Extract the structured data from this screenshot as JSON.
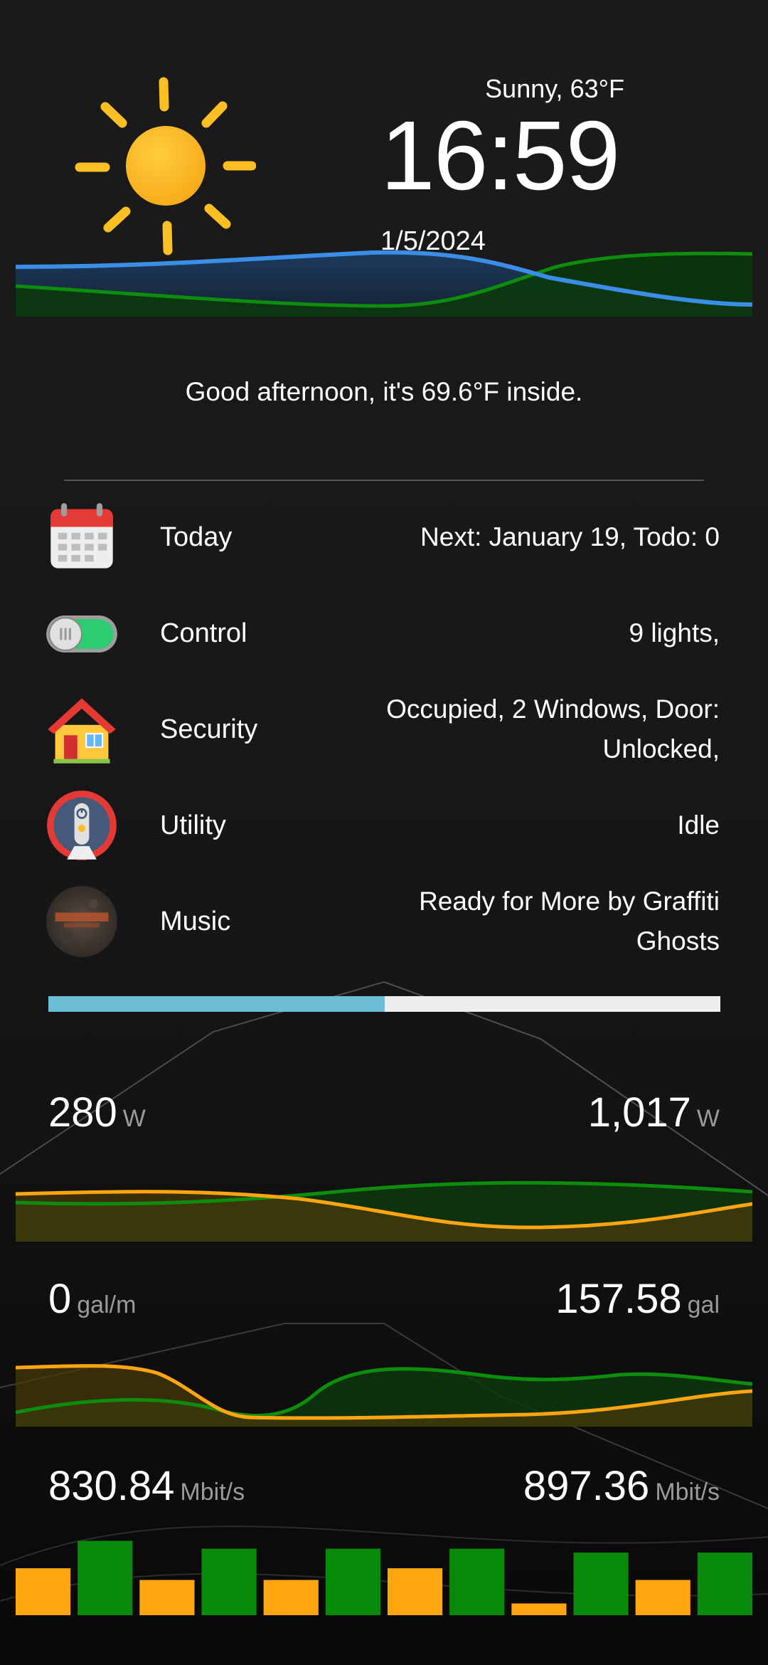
{
  "weather": {
    "condition": "Sunny, 63°F",
    "icon": "sun-icon"
  },
  "clock": {
    "time": "16:59",
    "date": "1/5/2024"
  },
  "greeting": "Good afternoon, it's 69.6°F inside.",
  "rows": [
    {
      "label": "Today",
      "value": "Next: January 19, Todo: 0",
      "icon": "calendar-icon"
    },
    {
      "label": "Control",
      "value": "9 lights,",
      "icon": "toggle-switch-icon"
    },
    {
      "label": "Security",
      "value": "Occupied, 2 Windows, Door: Unlocked,",
      "icon": "house-icon"
    },
    {
      "label": "Utility",
      "value": "Idle",
      "icon": "power-remote-icon"
    },
    {
      "label": "Music",
      "value": "Ready for More by Graffiti Ghosts",
      "icon": "album-art-icon"
    }
  ],
  "music_progress": 0.5,
  "power": {
    "left_value": "280",
    "left_unit": "W",
    "right_value": "1,017",
    "right_unit": "W"
  },
  "water": {
    "left_value": "0",
    "left_unit": "gal/m",
    "right_value": "157.58",
    "right_unit": "gal"
  },
  "network": {
    "left_value": "830.84",
    "left_unit": "Mbit/s",
    "right_value": "897.36",
    "right_unit": "Mbit/s"
  },
  "network_bars": [
    0.6,
    0.95,
    0.45,
    0.85,
    0.45,
    0.85,
    0.6,
    0.85,
    0.15,
    0.8,
    0.45,
    0.8
  ],
  "colors": {
    "blue": "#3a8ee6",
    "green": "#0a8a0a",
    "orange": "#ffa510",
    "progress": "#6cbdd6"
  }
}
